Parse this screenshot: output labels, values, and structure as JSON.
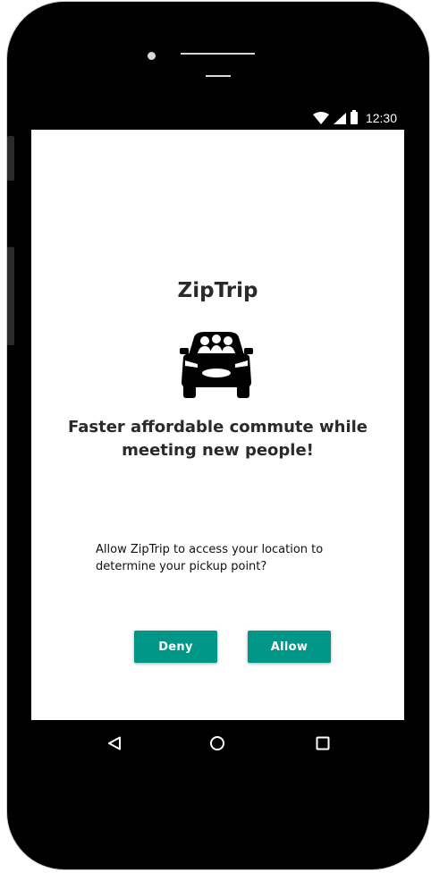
{
  "status_bar": {
    "time": "12:30"
  },
  "app": {
    "title": "ZipTrip",
    "logo_icon": "car-icon",
    "tagline": "Faster affordable commute while meeting new people!"
  },
  "permission": {
    "message": "Allow ZipTrip to access your location to determine your pickup point?",
    "deny_label": "Deny",
    "allow_label": "Allow"
  },
  "nav_bar": {
    "back_icon": "back-triangle-icon",
    "home_icon": "home-circle-icon",
    "recent_icon": "recent-square-icon"
  },
  "colors": {
    "accent": "#009688",
    "frame": "#000000",
    "text": "#2a2a2a"
  }
}
